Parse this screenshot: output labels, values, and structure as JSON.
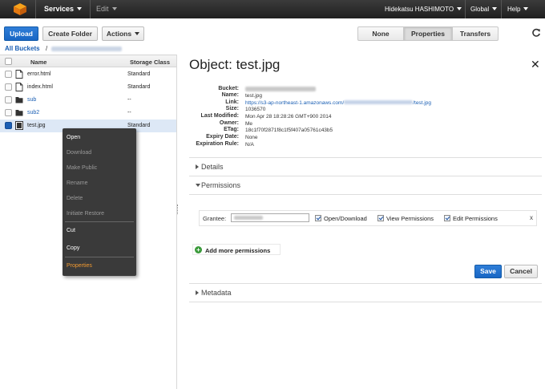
{
  "topbar": {
    "services": "Services",
    "edit": "Edit",
    "user": "Hidekatsu HASHIMOTO",
    "region": "Global",
    "help": "Help"
  },
  "toolbar": {
    "upload": "Upload",
    "create_folder": "Create Folder",
    "actions": "Actions",
    "view_none": "None",
    "view_properties": "Properties",
    "view_transfers": "Transfers"
  },
  "breadcrumb": {
    "all_buckets": "All Buckets",
    "separator": "/"
  },
  "list": {
    "col_name": "Name",
    "col_storage": "Storage Class",
    "rows": [
      {
        "name": "error.html",
        "storage": "Standard",
        "type": "file",
        "selected": false
      },
      {
        "name": "index.html",
        "storage": "Standard",
        "type": "file",
        "selected": false
      },
      {
        "name": "sub",
        "storage": "--",
        "type": "folder",
        "selected": false
      },
      {
        "name": "sub2",
        "storage": "--",
        "type": "folder",
        "selected": false
      },
      {
        "name": "test.jpg",
        "storage": "Standard",
        "type": "image",
        "selected": true
      }
    ]
  },
  "context_menu": {
    "open": "Open",
    "download": "Download",
    "make_public": "Make Public",
    "rename": "Rename",
    "delete": "Delete",
    "initiate_restore": "Initiate Restore",
    "cut": "Cut",
    "copy": "Copy",
    "properties": "Properties"
  },
  "object": {
    "title": "Object: test.jpg",
    "labels": {
      "bucket": "Bucket:",
      "name": "Name:",
      "link": "Link:",
      "size": "Size:",
      "last_modified": "Last Modified:",
      "owner": "Owner:",
      "etag": "ETag:",
      "expiry": "Expiry Date:",
      "expiration_rule": "Expiration Rule:"
    },
    "values": {
      "name": "test.jpg",
      "link_prefix": "https://s3-ap-northeast-1.amazonaws.com/",
      "link_suffix": "/test.jpg",
      "size": "1036570",
      "last_modified": "Mon Apr 28 18:28:26 GMT+900 2014",
      "owner": "Me",
      "etag": "18c1f70f2871f8c1f5f407a05761c43b5",
      "expiry": "None",
      "expiration_rule": "N/A"
    }
  },
  "sections": {
    "details": "Details",
    "permissions": "Permissions",
    "metadata": "Metadata"
  },
  "permissions": {
    "grantee_label": "Grantee:",
    "open_download": "Open/Download",
    "view_permissions": "View Permissions",
    "edit_permissions": "Edit Permissions",
    "remove": "x",
    "add_more": "Add more permissions",
    "save": "Save",
    "cancel": "Cancel"
  },
  "icons": [
    "aws-cube-icon",
    "refresh-icon",
    "close-icon",
    "file-icon",
    "folder-icon",
    "image-icon",
    "add-icon"
  ]
}
